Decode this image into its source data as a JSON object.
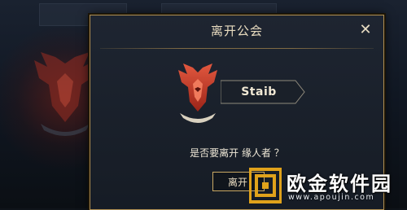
{
  "background": {
    "tab_1": "",
    "tab_2": ""
  },
  "dialog": {
    "title": "离开公会",
    "close_icon": "close-icon",
    "guild_name": "Staib",
    "question": "是否要离开  缘人者 ？",
    "confirm_label": "离开"
  },
  "watermark": {
    "title": "欧金软件园",
    "url": "www.apoujin.com"
  },
  "colors": {
    "accent_gold": "#b08f52",
    "emblem_red": "#c8372a",
    "banner_fill": "#1a2029"
  }
}
